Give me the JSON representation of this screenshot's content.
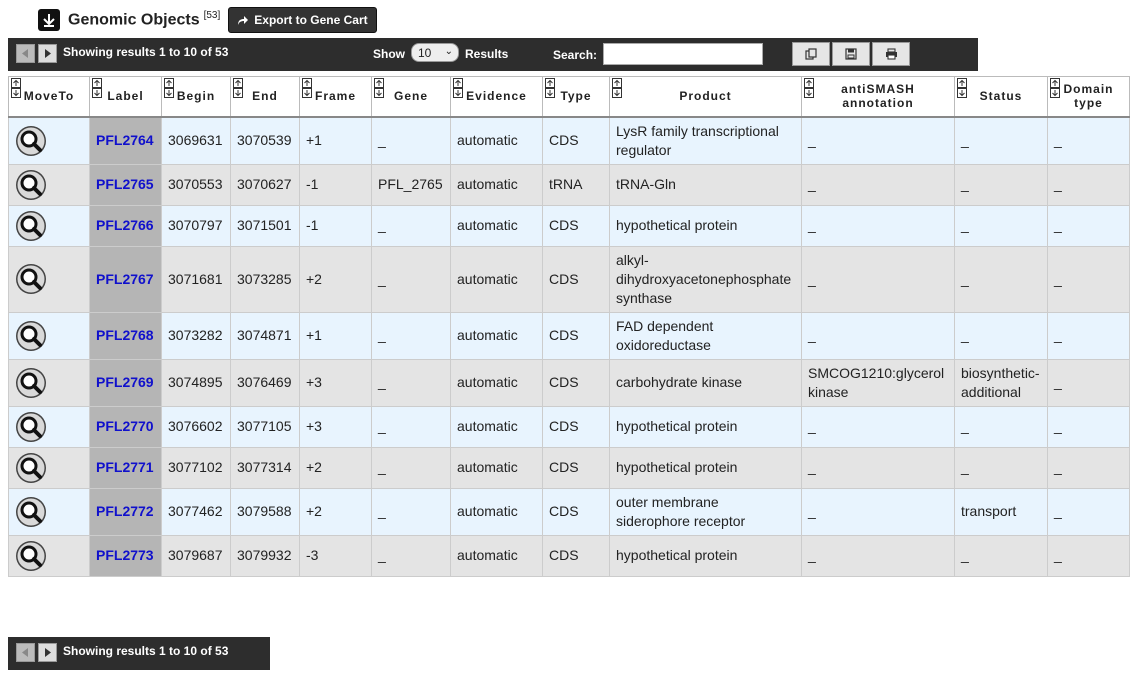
{
  "header": {
    "title": "Genomic Objects",
    "count": "[53]",
    "export_label": "Export to Gene Cart"
  },
  "toolbar": {
    "showing": "Showing results 1 to 10 of 53",
    "show_label": "Show",
    "page_length": "10",
    "results_label": "Results",
    "search_label": "Search:",
    "search_value": ""
  },
  "columns": [
    "MoveTo",
    "Label",
    "Begin",
    "End",
    "Frame",
    "Gene",
    "Evidence",
    "Type",
    "Product",
    "antiSMASH annotation",
    "Status",
    "Domain type"
  ],
  "rows": [
    {
      "label": "PFL2764",
      "begin": "3069631",
      "end": "3070539",
      "frame": "+1",
      "gene": "_",
      "evidence": "automatic",
      "type": "CDS",
      "product": "LysR family transcriptional regulator",
      "antismash": "_",
      "status": "_",
      "domain": "_"
    },
    {
      "label": "PFL2765",
      "begin": "3070553",
      "end": "3070627",
      "frame": "-1",
      "gene": "PFL_2765",
      "evidence": "automatic",
      "type": "tRNA",
      "product": "tRNA-Gln",
      "antismash": "_",
      "status": "_",
      "domain": "_"
    },
    {
      "label": "PFL2766",
      "begin": "3070797",
      "end": "3071501",
      "frame": "-1",
      "gene": "_",
      "evidence": "automatic",
      "type": "CDS",
      "product": "hypothetical protein",
      "antismash": "_",
      "status": "_",
      "domain": "_"
    },
    {
      "label": "PFL2767",
      "begin": "3071681",
      "end": "3073285",
      "frame": "+2",
      "gene": "_",
      "evidence": "automatic",
      "type": "CDS",
      "product": "alkyl-dihydroxyacetonephosphate synthase",
      "antismash": "_",
      "status": "_",
      "domain": "_"
    },
    {
      "label": "PFL2768",
      "begin": "3073282",
      "end": "3074871",
      "frame": "+1",
      "gene": "_",
      "evidence": "automatic",
      "type": "CDS",
      "product": "FAD dependent oxidoreductase",
      "antismash": "_",
      "status": "_",
      "domain": "_"
    },
    {
      "label": "PFL2769",
      "begin": "3074895",
      "end": "3076469",
      "frame": "+3",
      "gene": "_",
      "evidence": "automatic",
      "type": "CDS",
      "product": "carbohydrate kinase",
      "antismash": "SMCOG1210:glycerol kinase",
      "status": "biosynthetic-additional",
      "domain": "_"
    },
    {
      "label": "PFL2770",
      "begin": "3076602",
      "end": "3077105",
      "frame": "+3",
      "gene": "_",
      "evidence": "automatic",
      "type": "CDS",
      "product": "hypothetical protein",
      "antismash": "_",
      "status": "_",
      "domain": "_"
    },
    {
      "label": "PFL2771",
      "begin": "3077102",
      "end": "3077314",
      "frame": "+2",
      "gene": "_",
      "evidence": "automatic",
      "type": "CDS",
      "product": "hypothetical protein",
      "antismash": "_",
      "status": "_",
      "domain": "_"
    },
    {
      "label": "PFL2772",
      "begin": "3077462",
      "end": "3079588",
      "frame": "+2",
      "gene": "_",
      "evidence": "automatic",
      "type": "CDS",
      "product": "outer membrane siderophore receptor",
      "antismash": "_",
      "status": "transport",
      "domain": "_"
    },
    {
      "label": "PFL2773",
      "begin": "3079687",
      "end": "3079932",
      "frame": "-3",
      "gene": "_",
      "evidence": "automatic",
      "type": "CDS",
      "product": "hypothetical protein",
      "antismash": "_",
      "status": "_",
      "domain": "_"
    }
  ],
  "colors": {
    "toolbar": "#2d2d2d",
    "row_odd": "#e8f4fe",
    "row_even": "#e4e4e4",
    "label_cell": "#b5b5b5",
    "link": "#1010cc"
  }
}
